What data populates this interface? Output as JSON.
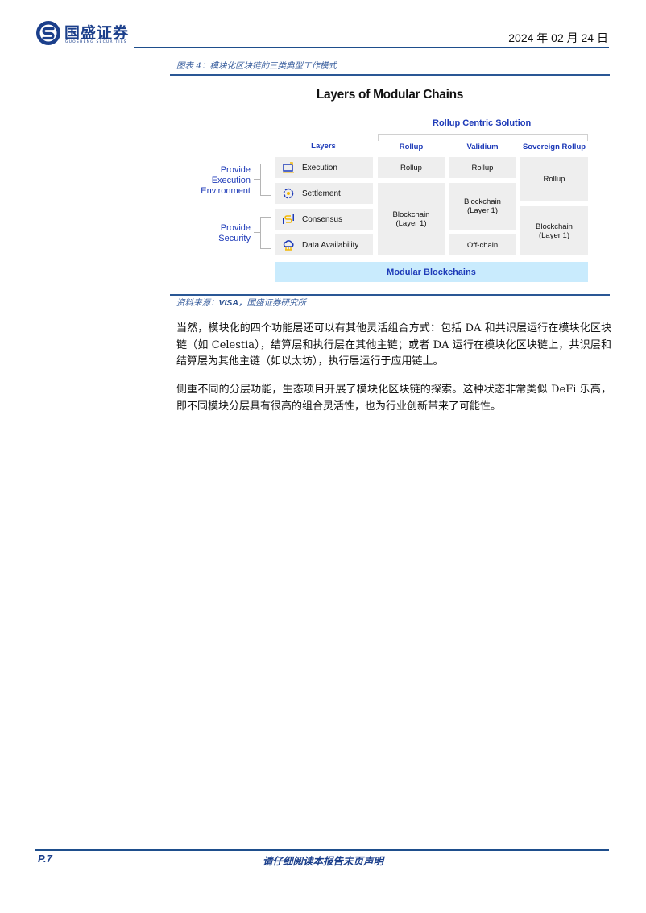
{
  "header": {
    "logo_cn": "国盛证券",
    "logo_en": "GUOSHENG SECURITIES",
    "date": "2024 年 02 月 24 日"
  },
  "figure": {
    "caption": "图表 4：模块化区块链的三类典型工作模式",
    "source_prefix": "资料来源：",
    "source_org": "VISA",
    "source_suffix": "，国盛证券研究所",
    "diagram": {
      "title": "Layers of Modular Chains",
      "group_title": "Rollup Centric Solution",
      "layers_header": "Layers",
      "side_labels": {
        "execution_env": [
          "Provide",
          "Execution",
          "Environment"
        ],
        "security": [
          "Provide",
          "Security"
        ]
      },
      "layers": [
        {
          "label": "Execution",
          "icon": "laptop-icon"
        },
        {
          "label": "Settlement",
          "icon": "gear-icon"
        },
        {
          "label": "Consensus",
          "icon": "consensus-icon"
        },
        {
          "label": "Data Availability",
          "icon": "cloud-icon"
        }
      ],
      "columns": [
        {
          "header": "Rollup",
          "cells": [
            "Rollup",
            "Blockchain\n(Layer 1)"
          ]
        },
        {
          "header": "Validium",
          "cells": [
            "Rollup",
            "Blockchain\n(Layer 1)",
            "Off-chain"
          ]
        },
        {
          "header": "Sovereign Rollup",
          "cells": [
            "Rollup",
            "Blockchain\n(Layer 1)"
          ]
        }
      ],
      "base_bar": "Modular Blockchains",
      "colors": {
        "accent": "#1d3ab8",
        "cell_bg": "#eeeeee",
        "base_bg": "#c9ebfd",
        "icon_yellow": "#f2b705"
      }
    }
  },
  "paragraphs": [
    "当然，模块化的四个功能层还可以有其他灵活组合方式：包括 DA 和共识层运行在模块化区块链（如 Celestia），结算层和执行层在其他主链；或者 DA 运行在模块化区块链上，共识层和结算层为其他主链（如以太坊），执行层运行于应用链上。",
    "侧重不同的分层功能，生态项目开展了模块化区块链的探索。这种状态非常类似 DeFi 乐高，即不同模块分层具有很高的组合灵活性，也为行业创新带来了可能性。"
  ],
  "footer": {
    "page": "P.7",
    "note": "请仔细阅读本报告末页声明"
  }
}
